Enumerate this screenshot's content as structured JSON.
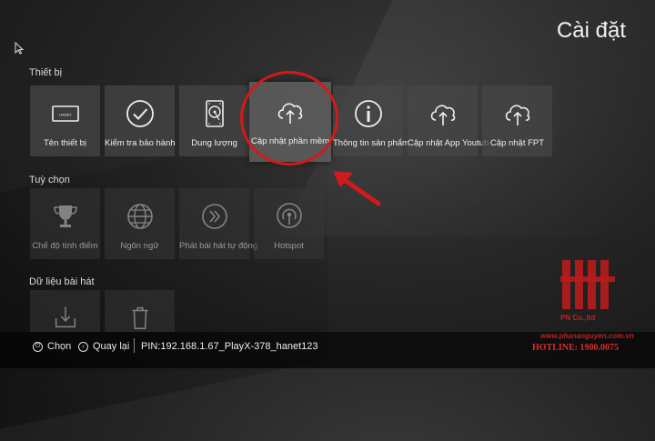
{
  "page": {
    "title": "Cài đặt"
  },
  "sections": [
    {
      "label": "Thiết bị"
    },
    {
      "label": "Tuỳ chọn"
    },
    {
      "label": "Dữ liệu bài hát"
    }
  ],
  "device_tiles": [
    {
      "label": "Tên thiết bị",
      "icon": "device-icon"
    },
    {
      "label": "Kiểm tra bảo hành",
      "icon": "checkmark-icon"
    },
    {
      "label": "Dung lượng",
      "icon": "hard-drive-icon"
    },
    {
      "label": "Cập nhật phần mềm",
      "icon": "cloud-upload-icon"
    },
    {
      "label": "Thông tin sản phẩm",
      "icon": "info-icon"
    },
    {
      "label": "Cập nhật App Youtub",
      "icon": "cloud-upload-icon"
    },
    {
      "label": "Cập nhật FPT",
      "icon": "cloud-upload-icon"
    }
  ],
  "device_badge": "HANET",
  "option_tiles": [
    {
      "label": "Chế độ tính điểm",
      "icon": "trophy-icon"
    },
    {
      "label": "Ngôn ngữ",
      "icon": "globe-icon"
    },
    {
      "label": "Phát bài hát tự động",
      "icon": "double-chevron-icon"
    },
    {
      "label": "Hotspot",
      "icon": "hotspot-icon"
    }
  ],
  "song_tiles": [
    {
      "label": "",
      "icon": "download-icon"
    },
    {
      "label": "",
      "icon": "trash-icon"
    }
  ],
  "footer": {
    "select_label": "Chọn",
    "back_label": "Quay lại",
    "pin_text": "PIN:192.168.1.67_PlayX-378_hanet123"
  },
  "watermark": {
    "company": "PN Co.,ltd",
    "website": "www.phananguyen.com.vn",
    "hotline": "HOTLINE: 1900.0075"
  },
  "colors": {
    "highlight": "#d11a1a",
    "tile": "#464646",
    "accent_red": "#c02020"
  }
}
